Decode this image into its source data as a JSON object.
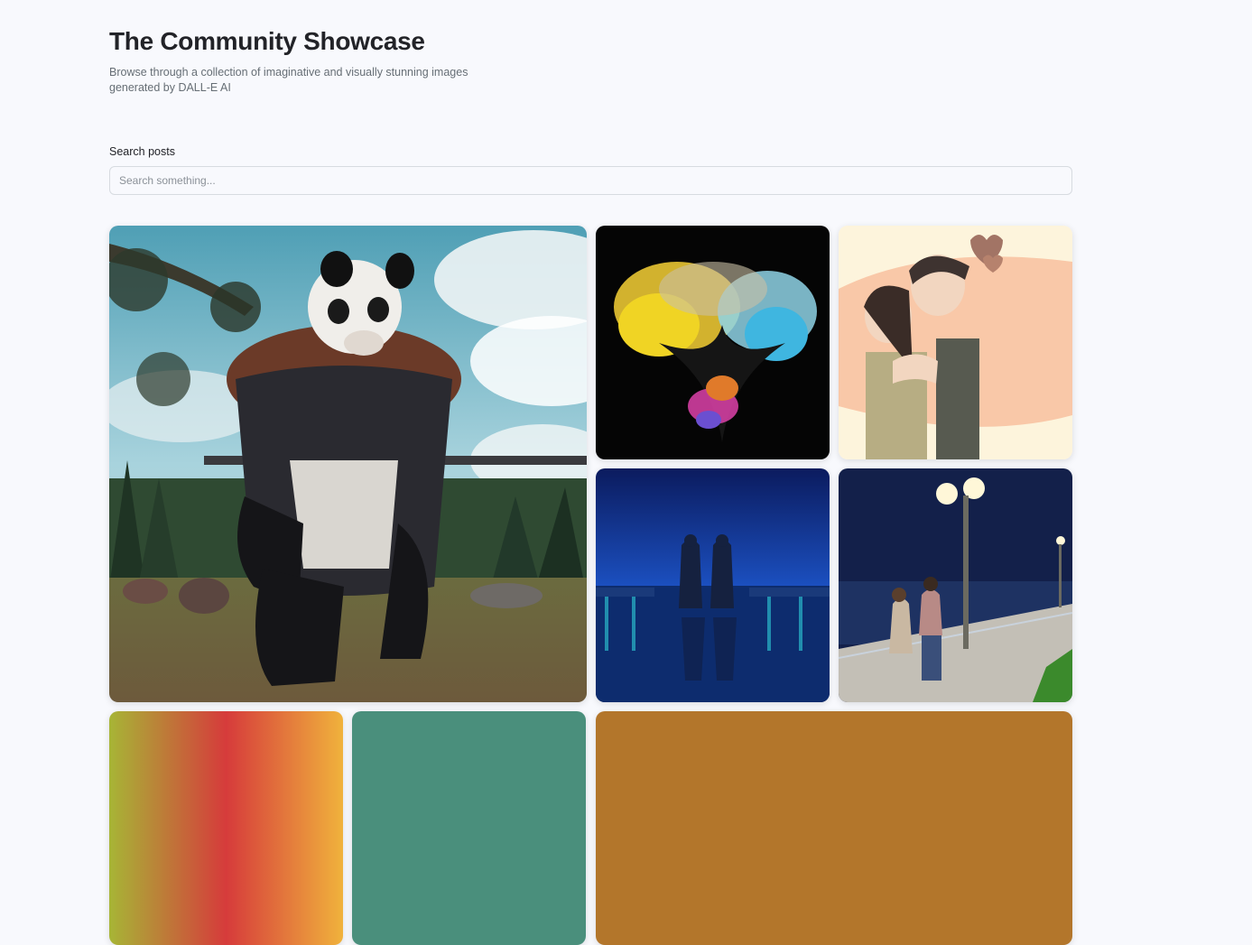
{
  "header": {
    "title": "The Community Showcase",
    "subtitle": "Browse through a collection of imaginative and visually stunning images generated by DALL-E AI"
  },
  "search": {
    "label": "Search posts",
    "placeholder": "Search something...",
    "value": ""
  },
  "colors": {
    "background": "#f8f9fd",
    "title": "#222328",
    "muted": "#666e75",
    "border": "#d7dbe0"
  }
}
